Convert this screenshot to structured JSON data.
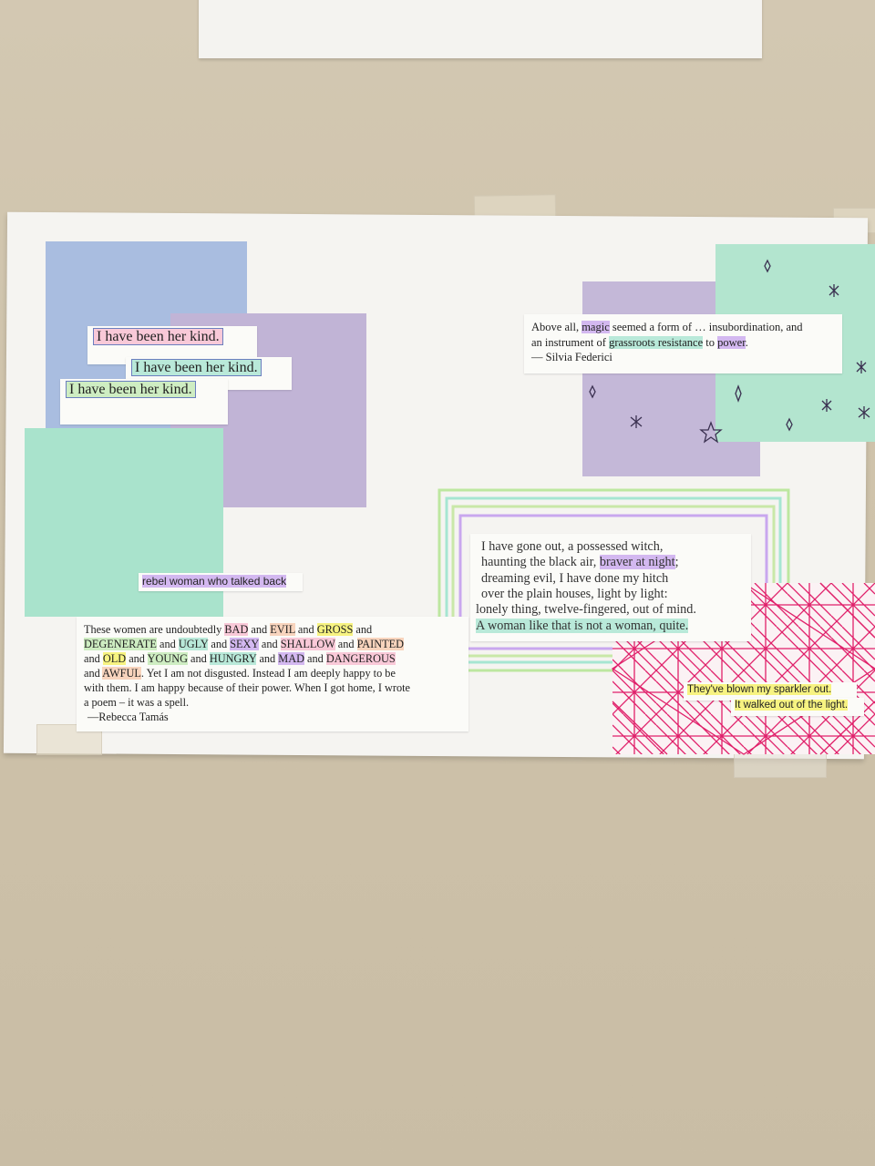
{
  "kind_strips": [
    "I have been her kind.",
    "I have been her kind.",
    "I have been her kind."
  ],
  "rebel_strip": "rebel woman who talked back",
  "federici": {
    "l1a": "Above all, ",
    "l1b": "magic",
    "l1c": " seemed a form of … ",
    "l1d": "insubordination, and",
    "l2a": "an instrument of ",
    "l2b": "grassroots resistance",
    "l2c": " to ",
    "l2d": "power",
    "l2e": ".",
    "l3": "— Silvia Federici"
  },
  "sexton": {
    "l1": "I have gone out, a possessed witch,",
    "l2a": "haunting the black air, ",
    "l2b": "braver at night",
    "l2c": ";",
    "l3": "dreaming evil, I have done my hitch",
    "l4": "over the plain houses, light by light:",
    "l5": "lonely thing, twelve-fingered, out of mind.",
    "l6": "A woman like that is not a woman, quite."
  },
  "tamas": {
    "t1": "These women are undoubtedly ",
    "w_bad": "BAD",
    "t2": " and ",
    "w_evil": "EVIL",
    "t3": " and ",
    "w_gross": "GROSS",
    "t4": " and",
    "w_degenerate": "DEGENERATE",
    "t5": " and ",
    "w_ugly": "UGLY",
    "t6": " and ",
    "w_sexy": "SEXY",
    "t7": " and ",
    "w_shallow": "SHALLOW",
    "t8": " and ",
    "w_painted": "PAINTED",
    "t9": "and ",
    "w_old": "OLD",
    "t10": " and ",
    "w_young": "YOUNG",
    "t11": " and ",
    "w_hungry": "HUNGRY",
    "t12": " and ",
    "w_mad": "MAD",
    "t13": " and ",
    "w_dangerous": "DANGEROUS",
    "t14": "and ",
    "w_awful": "AWFUL",
    "t15": ". Yet I am not disgusted. Instead I am deeply happy to be",
    "t16": "with them. I am happy because of their power. When I got home, I wrote",
    "t17": "a poem – it was a spell.",
    "attr": "—Rebecca Tamás"
  },
  "sparkler": {
    "l1": "They've blown my sparkler out.",
    "l2": "It walked out of the light."
  },
  "colors": {
    "wall": "#cfc3ab",
    "paper": "#f5f4f1",
    "blue": "#a9bde0",
    "purple": "#c1b4d6",
    "mint": "#a9e3cc",
    "pink_ink": "#e0206a"
  }
}
